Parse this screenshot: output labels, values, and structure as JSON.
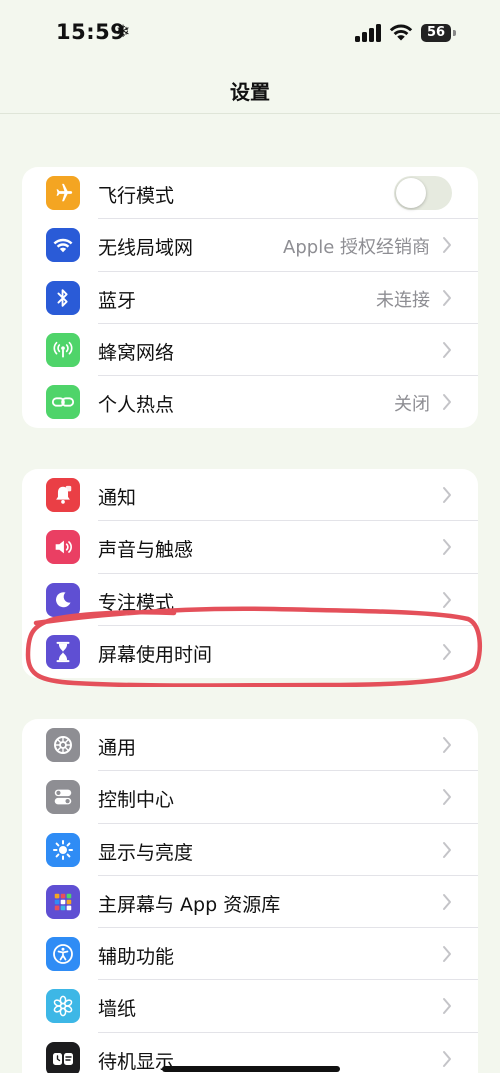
{
  "status_bar": {
    "time": "15:59",
    "weather_glyph": "❄",
    "battery": "56"
  },
  "nav": {
    "title": "设置"
  },
  "groups": [
    {
      "items": [
        {
          "label": "飞行模式",
          "icon": "airplane-icon",
          "color": "#f4a522",
          "toggle": false
        },
        {
          "label": "无线局域网",
          "value": "Apple 授权经销商",
          "icon": "wifi-icon",
          "color": "#2a5bd7"
        },
        {
          "label": "蓝牙",
          "value": "未连接",
          "icon": "bluetooth-icon",
          "color": "#2a5bd7"
        },
        {
          "label": "蜂窝网络",
          "icon": "cellular-icon",
          "color": "#4fd46a"
        },
        {
          "label": "个人热点",
          "value": "关闭",
          "icon": "hotspot-icon",
          "color": "#4fd46a"
        }
      ]
    },
    {
      "items": [
        {
          "label": "通知",
          "icon": "notification-bell-icon",
          "color": "#ea3f45"
        },
        {
          "label": "声音与触感",
          "icon": "speaker-icon",
          "color": "#ea3f63"
        },
        {
          "label": "专注模式",
          "icon": "moon-icon",
          "color": "#5f4fd3"
        },
        {
          "label": "屏幕使用时间",
          "icon": "hourglass-icon",
          "color": "#5f4fd3"
        }
      ]
    },
    {
      "items": [
        {
          "label": "通用",
          "icon": "gear-icon",
          "color": "#8e8e93"
        },
        {
          "label": "控制中心",
          "icon": "switches-icon",
          "color": "#8e8e93"
        },
        {
          "label": "显示与亮度",
          "icon": "sun-icon",
          "color": "#2f8cf5"
        },
        {
          "label": "主屏幕与 App 资源库",
          "icon": "home-grid-icon",
          "color": "#5f4fd3"
        },
        {
          "label": "辅助功能",
          "icon": "accessibility-icon",
          "color": "#2f8cf5"
        },
        {
          "label": "墙纸",
          "icon": "flower-icon",
          "color": "#3db7e6"
        },
        {
          "label": "待机显示",
          "icon": "standby-icon",
          "color": "#1c1c1e"
        }
      ]
    }
  ],
  "annotation": {
    "highlight_color": "#e4505a"
  }
}
